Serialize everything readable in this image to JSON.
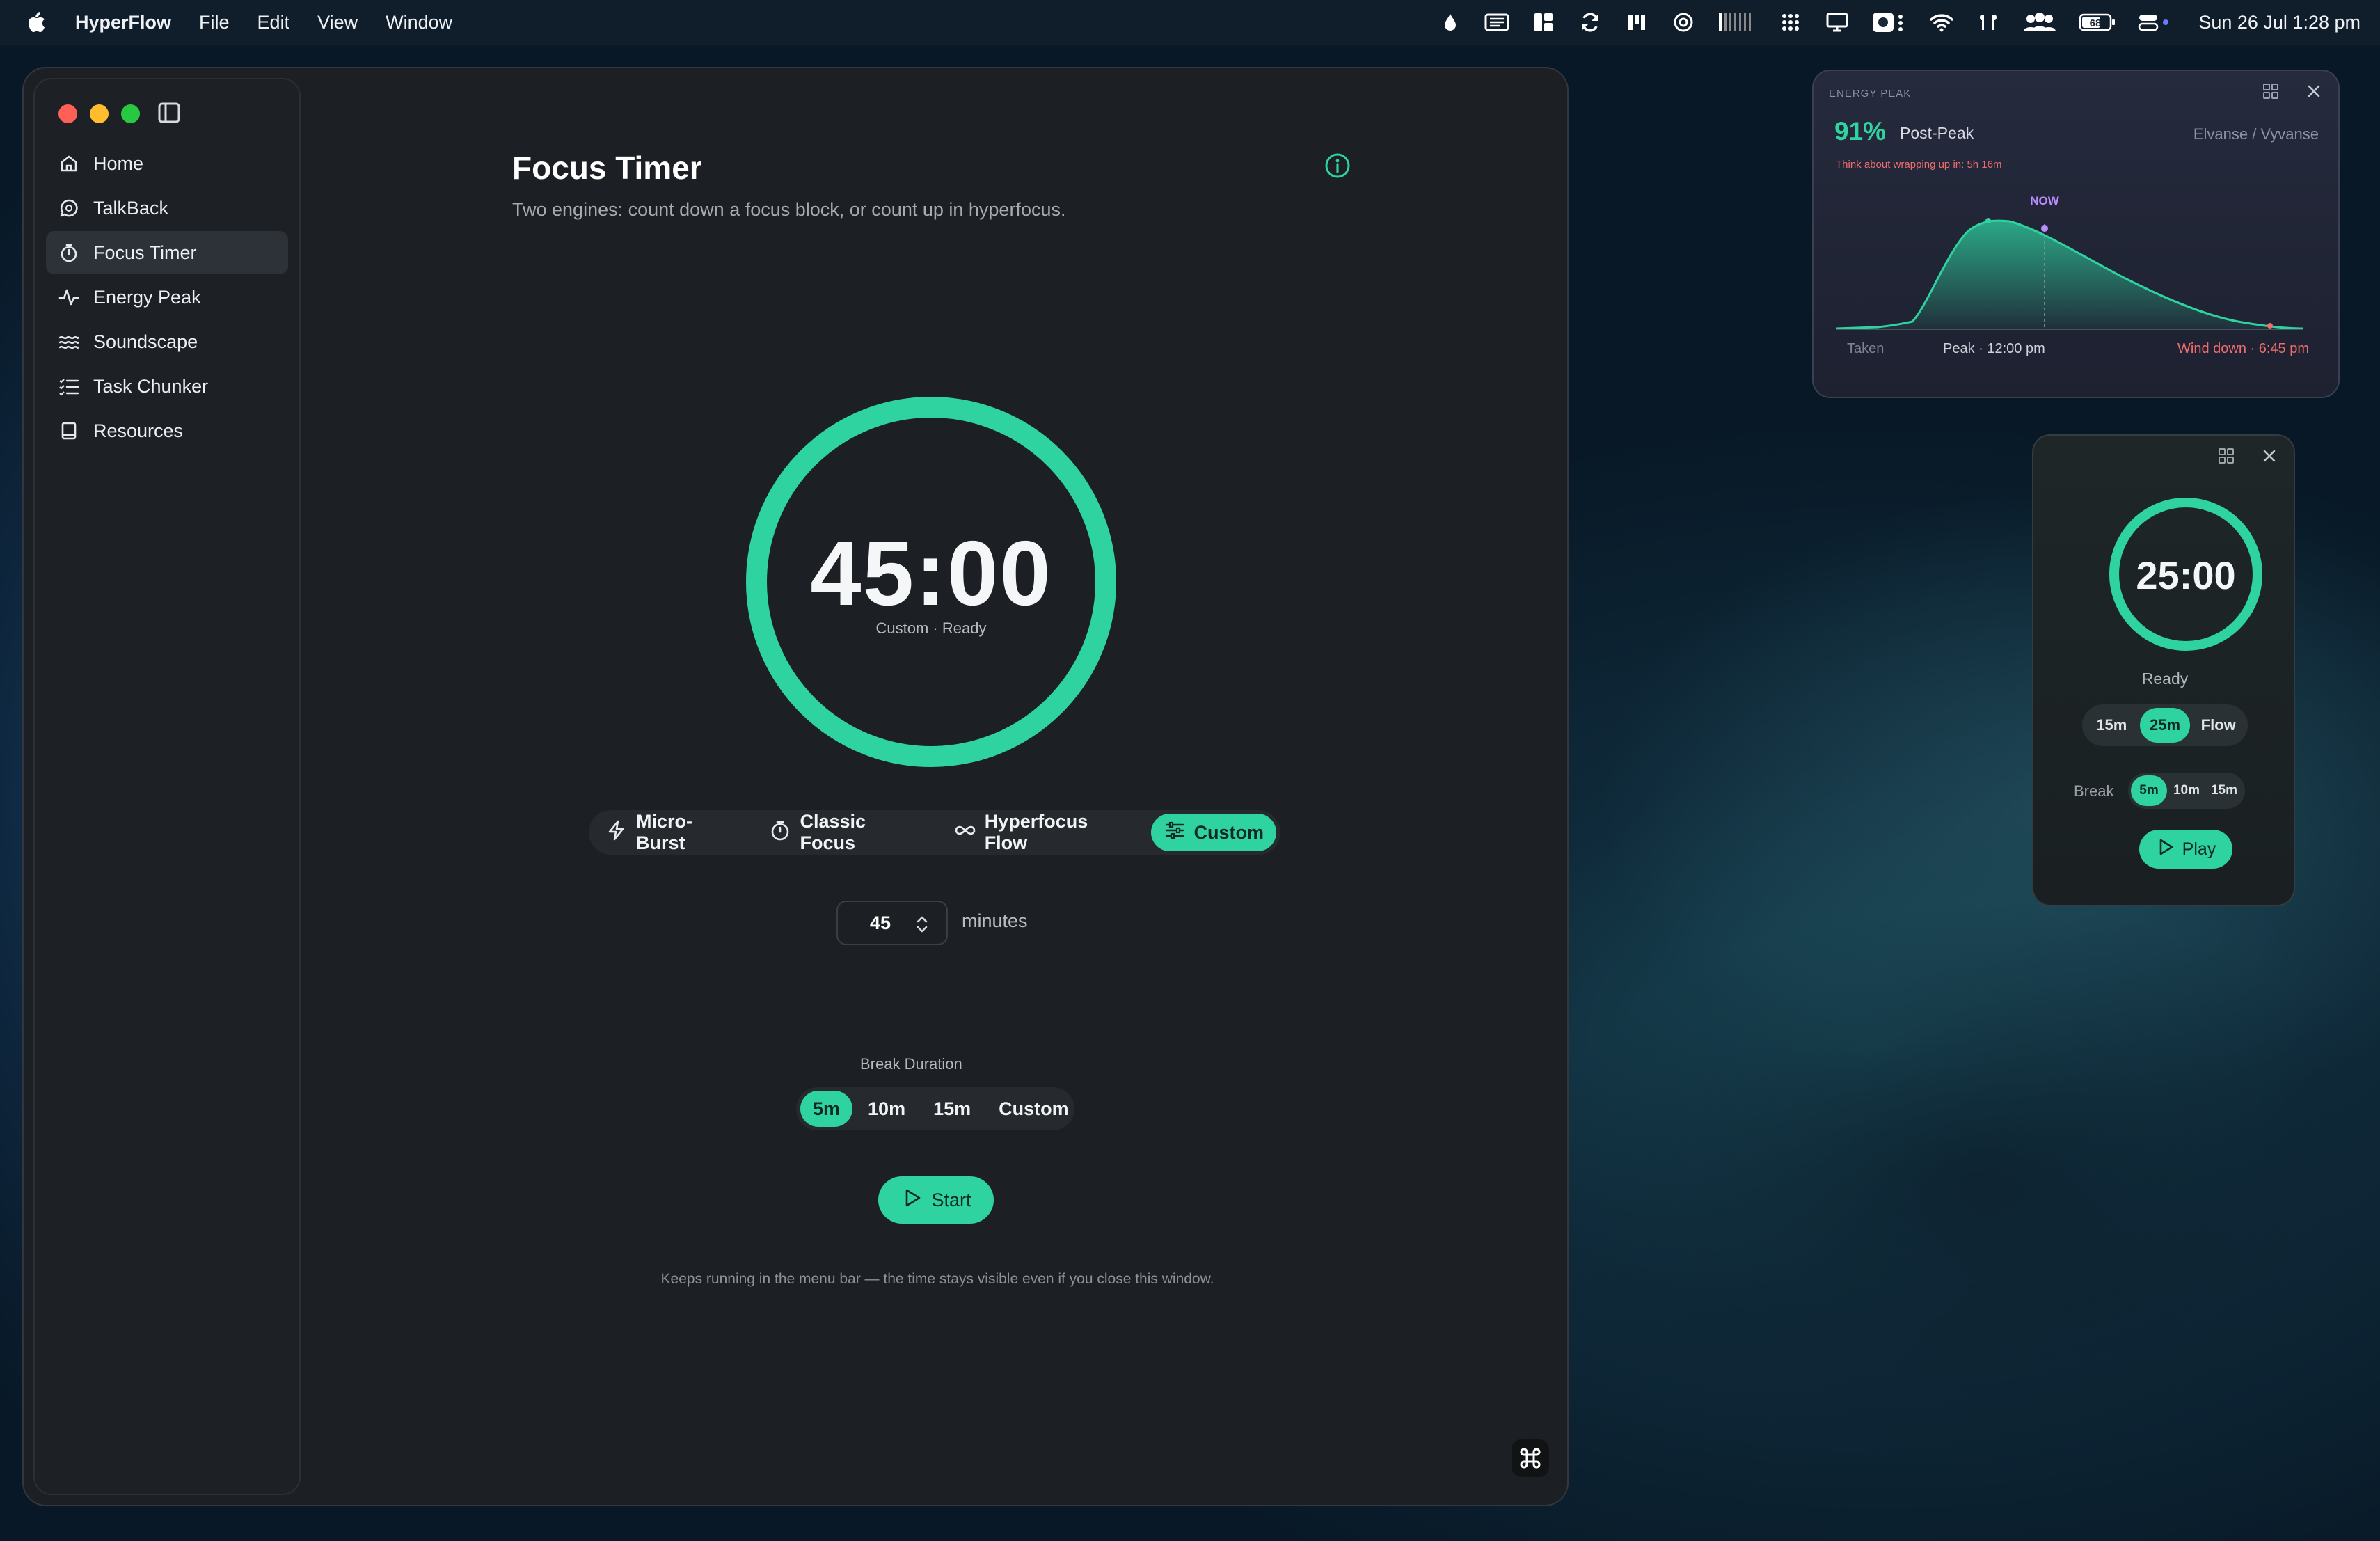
{
  "menubar": {
    "app_name": "HyperFlow",
    "menus": [
      "File",
      "Edit",
      "View",
      "Window"
    ],
    "tray_icons": [
      "drop-icon",
      "news-icon",
      "layout-icon",
      "sync-icon",
      "wand-icon",
      "target-icon",
      "bars-icon",
      "grid-icon",
      "display-icon",
      "record-icon",
      "wifi-icon",
      "airpods-icon",
      "users-icon",
      "battery-icon",
      "control-center-icon"
    ],
    "battery_level": "68",
    "clock": "Sun 26 Jul  1:28 pm"
  },
  "sidebar": {
    "items": [
      {
        "label": "Home",
        "icon": "home-icon"
      },
      {
        "label": "TalkBack",
        "icon": "chat-icon"
      },
      {
        "label": "Focus Timer",
        "icon": "stopwatch-icon",
        "active": true
      },
      {
        "label": "Energy Peak",
        "icon": "pulse-icon"
      },
      {
        "label": "Soundscape",
        "icon": "waves-icon"
      },
      {
        "label": "Task Chunker",
        "icon": "checklist-icon"
      },
      {
        "label": "Resources",
        "icon": "book-icon"
      }
    ]
  },
  "main": {
    "title": "Focus Timer",
    "subtitle": "Two engines: count down a focus block, or count up in hyperfocus.",
    "timer": {
      "time": "45:00",
      "status": "Custom · Ready",
      "progress": 1.0
    },
    "modes": [
      {
        "label": "Micro-Burst",
        "icon": "bolt-icon"
      },
      {
        "label": "Classic Focus",
        "icon": "stopwatch-icon"
      },
      {
        "label": "Hyperfocus Flow",
        "icon": "infinity-icon"
      },
      {
        "label": "Custom",
        "icon": "sliders-icon",
        "selected": true
      }
    ],
    "minutes_value": "45",
    "minutes_label": "minutes",
    "break_label": "Break Duration",
    "breaks": [
      {
        "label": "5m",
        "selected": true
      },
      {
        "label": "10m"
      },
      {
        "label": "15m"
      },
      {
        "label": "Custom"
      }
    ],
    "start_label": "Start",
    "footnote": "Keeps running in the menu bar — the time stays visible even if you close this window."
  },
  "energy_widget": {
    "header": "ENERGY PEAK",
    "percent": "91%",
    "phase": "Post-Peak",
    "medication": "Elvanse / Vyvanse",
    "warning": "Think about wrapping up in: 5h 16m",
    "now_label": "NOW",
    "taken_label": "Taken",
    "peak_label": "Peak · 12:00 pm",
    "wind_label": "Wind down · 6:45 pm"
  },
  "mini_timer": {
    "time": "25:00",
    "status": "Ready",
    "durations": [
      {
        "label": "15m"
      },
      {
        "label": "25m",
        "selected": true
      },
      {
        "label": "Flow"
      }
    ],
    "break_label": "Break",
    "breaks": [
      {
        "label": "5m",
        "selected": true
      },
      {
        "label": "10m"
      },
      {
        "label": "15m"
      }
    ],
    "play_label": "Play"
  },
  "colors": {
    "accent": "#2ed3a0",
    "window_bg": "#1c1f23",
    "warning": "#ef6d6d",
    "now_marker": "#b98cff"
  }
}
